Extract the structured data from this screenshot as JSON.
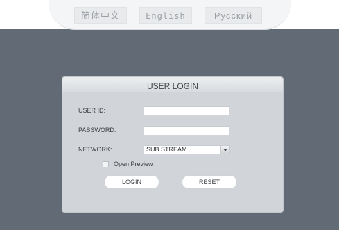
{
  "languages": [
    "简体中文",
    "English",
    "Русский"
  ],
  "login": {
    "title": "USER LOGIN",
    "user_id_label": "USER ID:",
    "user_id_value": "",
    "password_label": "PASSWORD:",
    "password_value": "",
    "network_label": "NETWORK:",
    "network_value": "SUB STREAM",
    "preview_label": "Open Preview",
    "preview_checked": false,
    "login_button": "LOGIN",
    "reset_button": "RESET"
  },
  "colors": {
    "background": "#626a75",
    "dialog": "#d1d4d8",
    "header_band": "#f4f5f6"
  }
}
